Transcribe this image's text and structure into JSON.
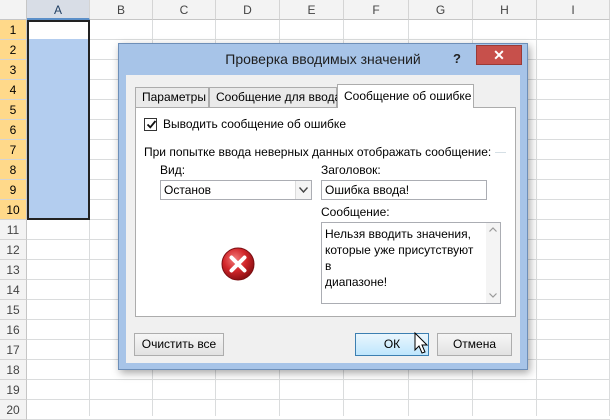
{
  "spreadsheet": {
    "columns": [
      "A",
      "B",
      "C",
      "D",
      "E",
      "F",
      "G",
      "H",
      "I"
    ],
    "rows": [
      "1",
      "2",
      "3",
      "4",
      "5",
      "6",
      "7",
      "8",
      "9",
      "10",
      "11",
      "12",
      "13",
      "14",
      "15",
      "16",
      "17",
      "18",
      "19",
      "20"
    ],
    "selected_column": "A",
    "selected_rows": [
      "1",
      "2",
      "3",
      "4",
      "5",
      "6",
      "7",
      "8",
      "9",
      "10"
    ],
    "selection_color": "#b3cdef"
  },
  "dialog": {
    "title": "Проверка вводимых значений",
    "help_label": "?",
    "close_label": "✕",
    "tabs": [
      {
        "label": "Параметры",
        "active": false
      },
      {
        "label": "Сообщение для ввода",
        "active": false
      },
      {
        "label": "Сообщение об ошибке",
        "active": true
      }
    ],
    "show_error_checkbox": {
      "label": "Выводить сообщение об ошибке",
      "checked": true
    },
    "group_label": "При попытке ввода неверных данных отображать сообщение:",
    "style": {
      "label": "Вид:",
      "value": "Останов"
    },
    "title_field": {
      "label": "Заголовок:",
      "value": "Ошибка ввода!"
    },
    "message_field": {
      "label": "Сообщение:",
      "value": "Нельзя вводить значения,\nкоторые уже присутствуют в\nдиапазоне!"
    },
    "icon": "stop-error-icon",
    "buttons": {
      "clear": "Очистить все",
      "ok": "ОК",
      "cancel": "Отмена"
    },
    "accent_close": "#c7504b",
    "titlebar_color": "#a7c4e8"
  }
}
